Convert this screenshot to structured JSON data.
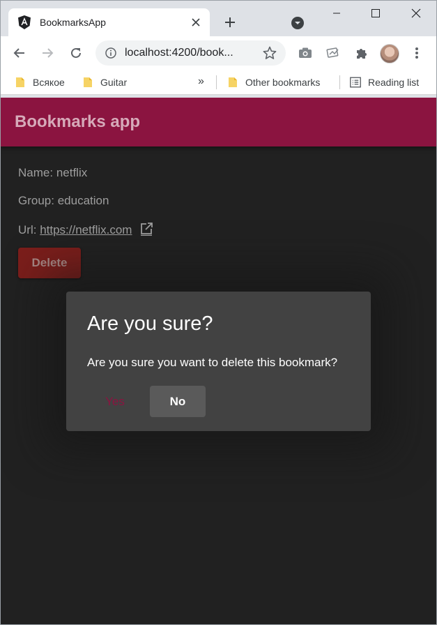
{
  "browser": {
    "tab_title": "BookmarksApp",
    "url": "localhost:4200/book...",
    "bookmarks_bar": {
      "items": [
        "Всякое",
        "Guitar"
      ],
      "overflow": "»",
      "other_bookmarks": "Other bookmarks",
      "reading_list": "Reading list"
    }
  },
  "app": {
    "title": "Bookmarks app",
    "bookmark": {
      "name_label": "Name:",
      "name": "netflix",
      "group_label": "Group:",
      "group": "education",
      "url_label": "Url:",
      "url": "https://netflix.com"
    },
    "delete_label": "Delete"
  },
  "dialog": {
    "title": "Are you sure?",
    "message": "Are you sure you want to delete this bookmark?",
    "yes_label": "Yes",
    "no_label": "No"
  },
  "colors": {
    "header": "#8b1440",
    "background": "#212121",
    "dialog": "#424242",
    "delete": "#7b1e1b"
  }
}
